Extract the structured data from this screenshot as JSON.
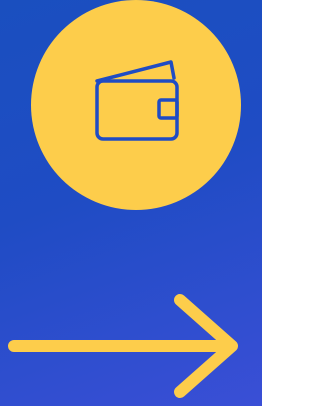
{
  "colors": {
    "background_start": "#1a4fbf",
    "background_end": "#3a4fd6",
    "accent_yellow": "#fdcd4b",
    "icon_stroke": "#1f4cc4"
  },
  "icons": {
    "primary": "wallet-icon",
    "secondary": "arrow-right-icon"
  }
}
